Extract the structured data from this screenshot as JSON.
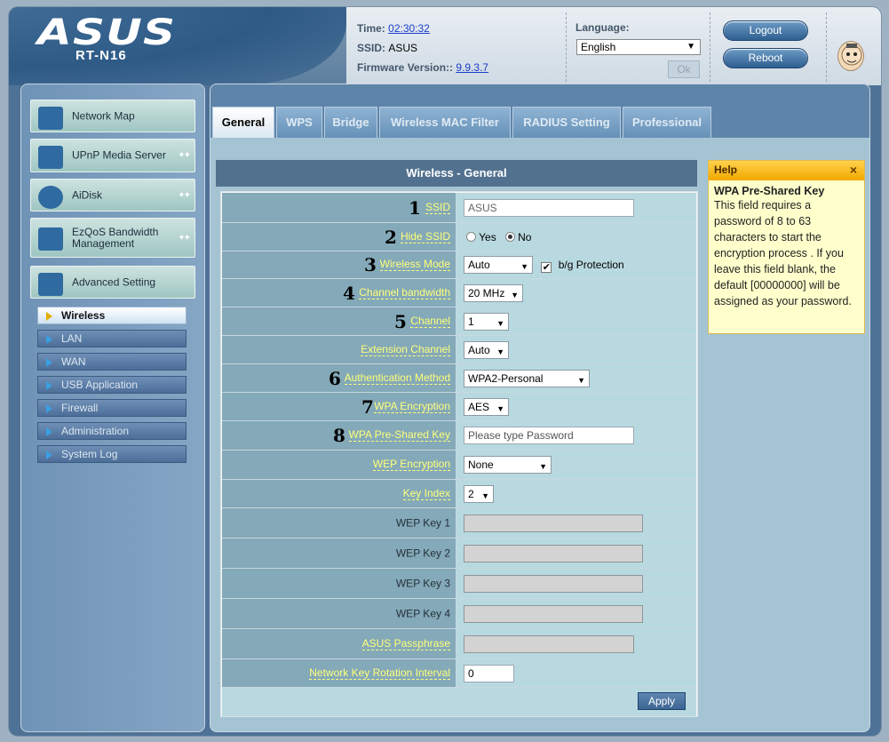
{
  "header": {
    "logo": "ASUS",
    "model": "RT-N16",
    "time_label": "Time:",
    "time_value": "02:30:32",
    "ssid_label": "SSID:",
    "ssid_value": "ASUS",
    "firmware_label": "Firmware Version::",
    "firmware_value": "9.9.3.7",
    "language_label": "Language:",
    "language_value": "English",
    "ok_label": "Ok",
    "logout_label": "Logout",
    "reboot_label": "Reboot"
  },
  "sidebar": {
    "menus": [
      {
        "label": "Network Map"
      },
      {
        "label": "UPnP Media Server"
      },
      {
        "label": "AiDisk"
      },
      {
        "label": "EzQoS Bandwidth Management"
      },
      {
        "label": "Advanced Setting"
      }
    ],
    "submenu": [
      {
        "label": "Wireless",
        "active": true
      },
      {
        "label": "LAN"
      },
      {
        "label": "WAN"
      },
      {
        "label": "USB Application"
      },
      {
        "label": "Firewall"
      },
      {
        "label": "Administration"
      },
      {
        "label": "System Log"
      }
    ]
  },
  "tabs": [
    "General",
    "WPS",
    "Bridge",
    "Wireless MAC Filter",
    "RADIUS Setting",
    "Professional"
  ],
  "panel": {
    "title_main": "Wireless",
    "title_sub": " - General",
    "rows": [
      {
        "num": "1",
        "label": "SSID",
        "value": "ASUS"
      },
      {
        "num": "2",
        "label": "Hide SSID",
        "opt_yes": "Yes",
        "opt_no": "No"
      },
      {
        "num": "3",
        "label": "Wireless Mode",
        "value": "Auto",
        "check_label": "b/g Protection"
      },
      {
        "num": "4",
        "label": "Channel bandwidth",
        "value": "20 MHz"
      },
      {
        "num": "5",
        "label": "Channel",
        "value": "1"
      },
      {
        "label": "Extension Channel",
        "value": "Auto"
      },
      {
        "num": "6",
        "label": "Authentication Method",
        "value": "WPA2-Personal"
      },
      {
        "num": "7",
        "label": "WPA Encryption",
        "value": "AES"
      },
      {
        "num": "8",
        "label": "WPA Pre-Shared Key",
        "placeholder": "Please type Password"
      },
      {
        "label": "WEP Encryption",
        "value": "None"
      },
      {
        "label": "Key Index",
        "value": "2"
      },
      {
        "label": "WEP Key 1"
      },
      {
        "label": "WEP Key 2"
      },
      {
        "label": "WEP Key 3"
      },
      {
        "label": "WEP Key 4"
      },
      {
        "label": "ASUS Passphrase"
      },
      {
        "label": "Network Key Rotation Interval",
        "value": "0"
      }
    ],
    "apply_label": "Apply"
  },
  "help": {
    "header": "Help",
    "close": "×",
    "title": "WPA Pre-Shared Key",
    "body": "This field requires a password of 8 to 63 characters to start the encryption process . If you leave this field blank, the default [00000000] will be assigned as your password."
  },
  "colors": {
    "accent": "#52718f",
    "label_text": "#ffff7a",
    "help_header": "#f1a800"
  }
}
